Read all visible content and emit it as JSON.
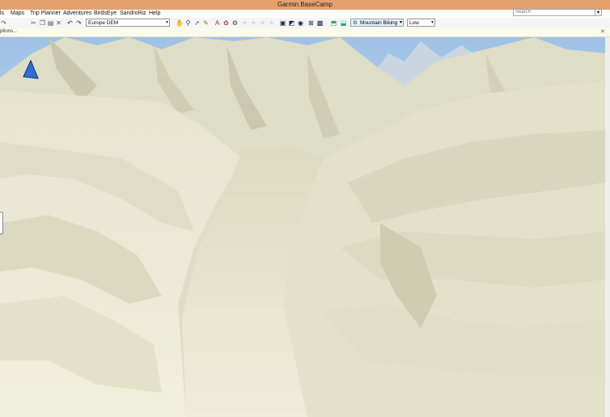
{
  "window": {
    "title": "Garmin BaseCamp"
  },
  "menu": [
    "ls",
    "Maps",
    "Trip Planner",
    "Adventures",
    "BirdsEye",
    "SandroRiz",
    "Help"
  ],
  "search": {
    "placeholder": "Search"
  },
  "toolbar": {
    "map_product": "Europe DEM",
    "activity_profile": "Mountain Biking",
    "detail_level": "Low"
  },
  "notification": {
    "text": "ptions..."
  }
}
